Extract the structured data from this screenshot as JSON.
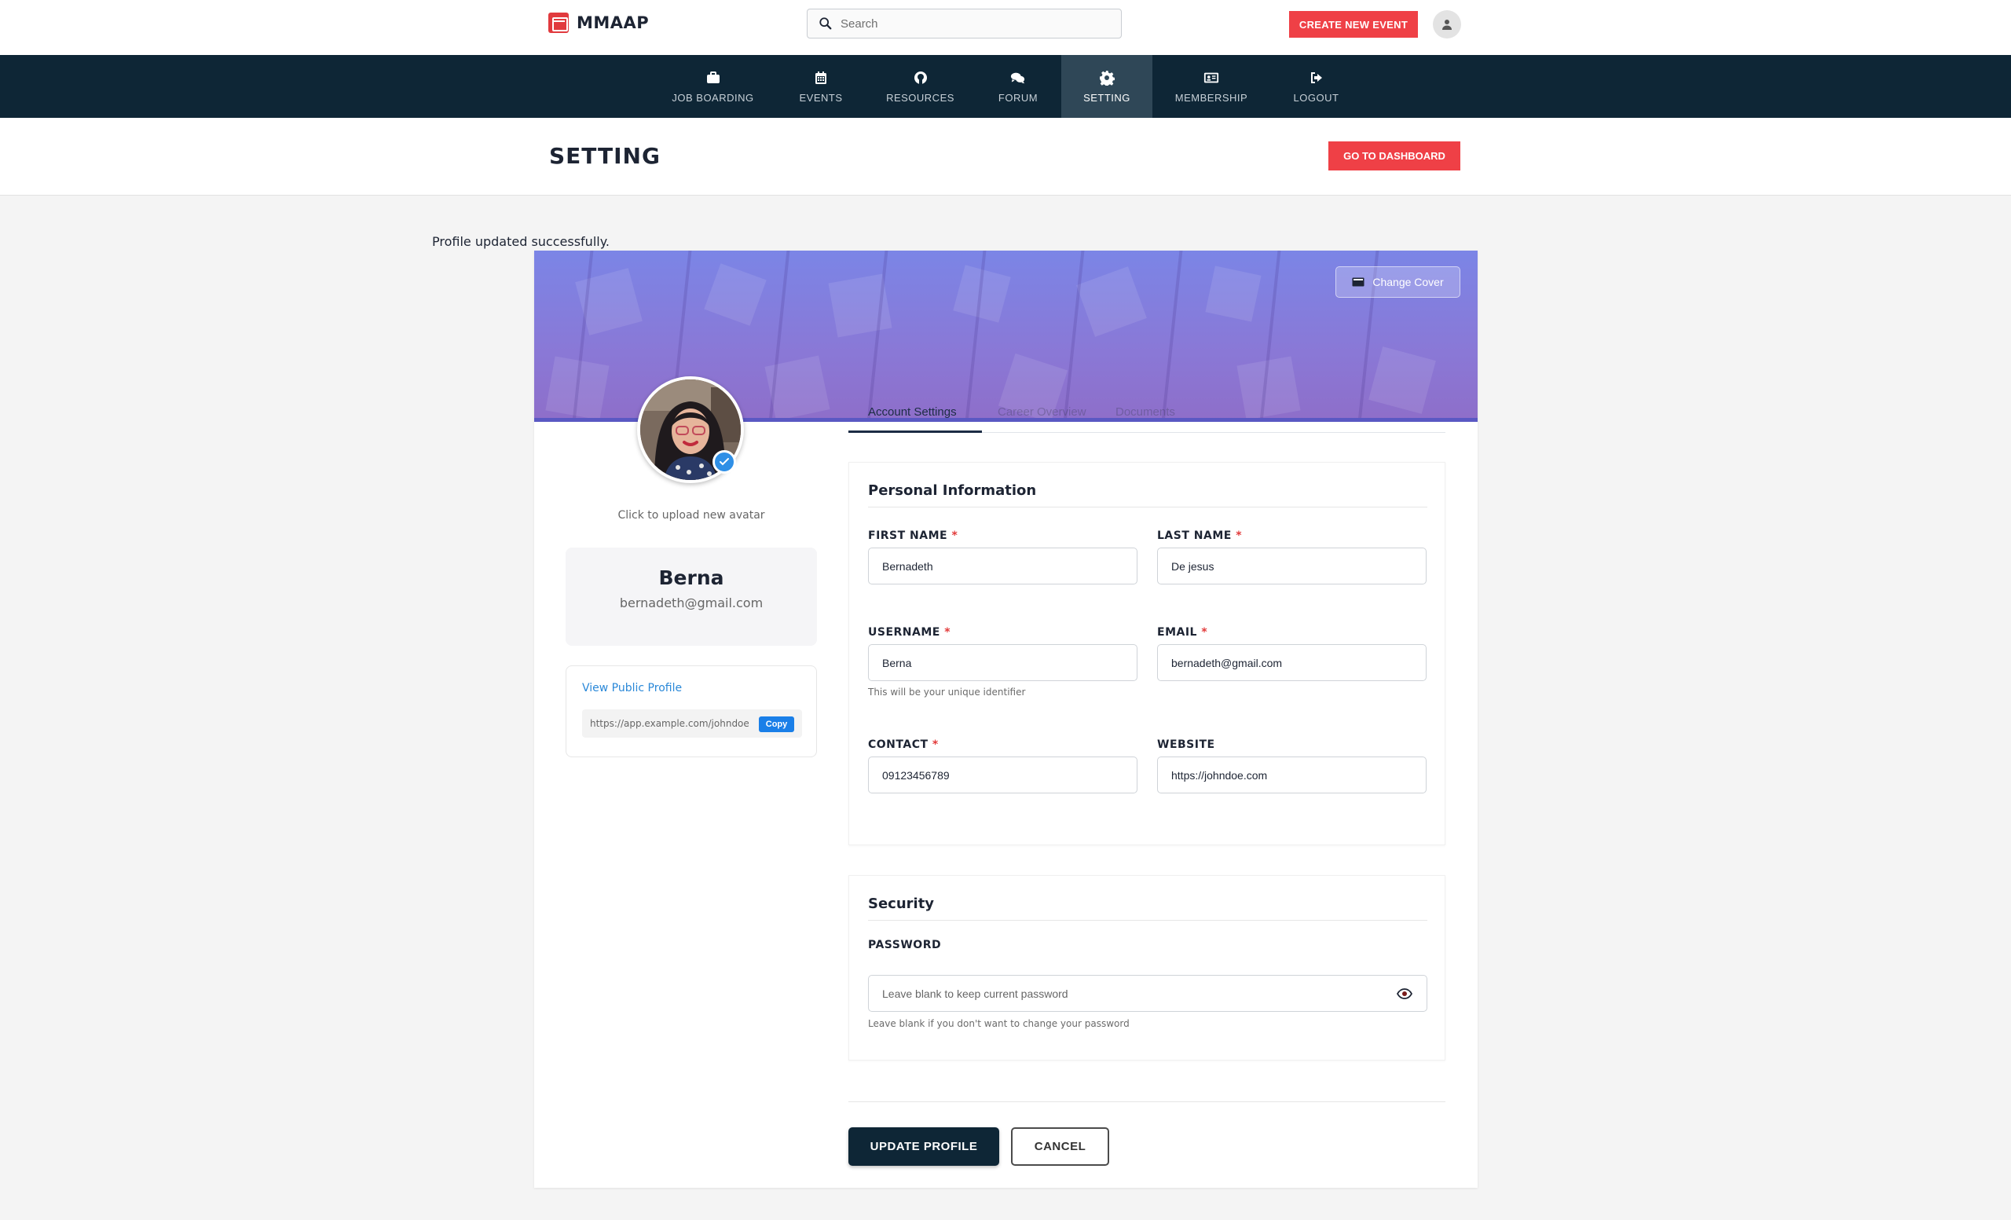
{
  "brand": {
    "name": "MMAAP",
    "accent": "#ef4046",
    "navy": "#0e2636"
  },
  "search": {
    "placeholder": "Search"
  },
  "header": {
    "create_event_label": "CREATE NEW EVENT"
  },
  "nav": {
    "items": [
      {
        "label": "JOB BOARDING",
        "icon": "briefcase-icon",
        "active": false
      },
      {
        "label": "EVENTS",
        "icon": "calendar-icon",
        "active": false
      },
      {
        "label": "RESOURCES",
        "icon": "github-icon",
        "active": false
      },
      {
        "label": "FORUM",
        "icon": "chat-bubbles-icon",
        "active": false
      },
      {
        "label": "SETTING",
        "icon": "gear-icon",
        "active": true
      },
      {
        "label": "MEMBERSHIP",
        "icon": "id-card-icon",
        "active": false
      },
      {
        "label": "LOGOUT",
        "icon": "logout-icon",
        "active": false
      }
    ]
  },
  "page": {
    "title": "SETTING",
    "dashboard_label": "GO TO DASHBOARD"
  },
  "flash": {
    "message": "Profile updated successfully."
  },
  "cover": {
    "change_label": "Change Cover"
  },
  "tabs": [
    {
      "label": "Account Settings",
      "active": true
    },
    {
      "label": "Career Overview",
      "active": false
    },
    {
      "label": "Documents",
      "active": false
    }
  ],
  "profile": {
    "upload_hint": "Click to upload new avatar",
    "name": "Berna",
    "email": "bernadeth@gmail.com",
    "public_link_label": "View Public Profile",
    "public_url": "https://app.example.com/johndoe",
    "copy_label": "Copy"
  },
  "personal": {
    "title": "Personal Information",
    "first_name": {
      "label": "FIRST NAME",
      "value": "Bernadeth"
    },
    "last_name": {
      "label": "LAST NAME",
      "value": "De jesus"
    },
    "username": {
      "label": "USERNAME",
      "value": "Berna",
      "help": "This will be your unique identifier"
    },
    "email": {
      "label": "EMAIL",
      "value": "bernadeth@gmail.com"
    },
    "contact": {
      "label": "CONTACT",
      "value": "09123456789"
    },
    "website": {
      "label": "WEBSITE",
      "value": "https://johndoe.com"
    }
  },
  "security": {
    "title": "Security",
    "password": {
      "label": "PASSWORD",
      "placeholder": "Leave blank to keep current password",
      "help": "Leave blank if you don't want to change your password"
    }
  },
  "actions": {
    "update_label": "UPDATE PROFILE",
    "cancel_label": "CANCEL"
  }
}
